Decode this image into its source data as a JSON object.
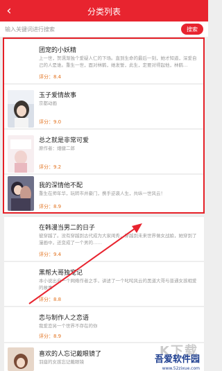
{
  "header": {
    "back_icon": "‹",
    "title": "分类列表"
  },
  "search": {
    "placeholder": "输入关键词进行搜索",
    "button": "搜索"
  },
  "books": [
    {
      "title": "团宠的小妖精",
      "desc": "上一世，贺濡渐独个爱疑人仁的下场。直到生命的最后一刻，她才知道，深爱自己的人是谁。重生一世，面对林鹤，她发誓，此生，定要对得起他，林鹤…",
      "score_label": "评分：",
      "score": "8.4",
      "cover": "none"
    },
    {
      "title": "玉子爱情故事",
      "desc": "京都动画",
      "score_label": "评分：",
      "score": "9.0",
      "cover": "art"
    },
    {
      "title": "总之就是非常可爱",
      "desc": "原作者：畑健二郎",
      "score_label": "评分：",
      "score": "9.2",
      "cover": "art"
    },
    {
      "title": "我的深情他不配",
      "desc": "重生在师年华，玩转市井豪门，携手逆袭人生，共纵一世风云！",
      "score_label": "评分：",
      "score": "8.9",
      "cover": "art"
    },
    {
      "title": "在韩漫当男二的日子",
      "desc": "彼穿越了。没有穿越到古代成为大家闺秀，穿越到未来世界做女战娘，她穿到了漫画中，还变成了一个男的……",
      "score_label": "评分：",
      "score": "9.4",
      "cover": "none"
    },
    {
      "title": "黑帮大哥独宠记",
      "desc": "本小说出自一个网络作者之手，讲述了一个叱咤风云的黑道大哥与普通女孩相爱的故事",
      "score_label": "评分：",
      "score": "8.8",
      "cover": "none"
    },
    {
      "title": "恋与制作人之恋语",
      "desc": "我爱恋另一个世界不存在的你",
      "score_label": "评分：",
      "score": "8.9",
      "cover": "none"
    },
    {
      "title": "喜欢的人忘记戴眼镜了",
      "desc": "羽座的女孩忘记戴眼镜",
      "score_label": "",
      "score": "",
      "cover": "art"
    }
  ],
  "watermark": {
    "big": "K下载",
    "name": "吾爱软件园",
    "url": "www.52zixue.com"
  },
  "colors": {
    "accent": "#e8242f",
    "score": "#e2711d"
  }
}
